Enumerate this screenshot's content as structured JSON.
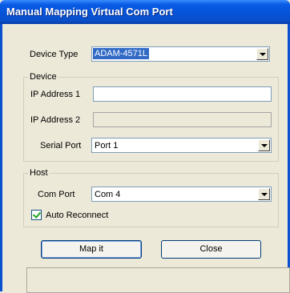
{
  "window": {
    "title": "Manual Mapping Virtual Com Port"
  },
  "device_type": {
    "label": "Device Type",
    "value": "ADAM-4571L"
  },
  "device_group": {
    "legend": "Device",
    "ip1_label": "IP Address 1",
    "ip1_value": "",
    "ip2_label": "IP Address 2",
    "ip2_value": "",
    "serial_label": "Serial Port",
    "serial_value": "Port 1"
  },
  "host_group": {
    "legend": "Host",
    "com_label": "Com Port",
    "com_value": "Com 4",
    "auto_label": "Auto Reconnect",
    "auto_checked": true
  },
  "buttons": {
    "map": "Map it",
    "close": "Close"
  },
  "icons": {
    "dropdown": "chevron-down-icon",
    "check": "checkmark-icon"
  },
  "colors": {
    "title_bar": "#0A5CE5",
    "selection": "#316AC5",
    "dialog": "#ECE9D8"
  }
}
